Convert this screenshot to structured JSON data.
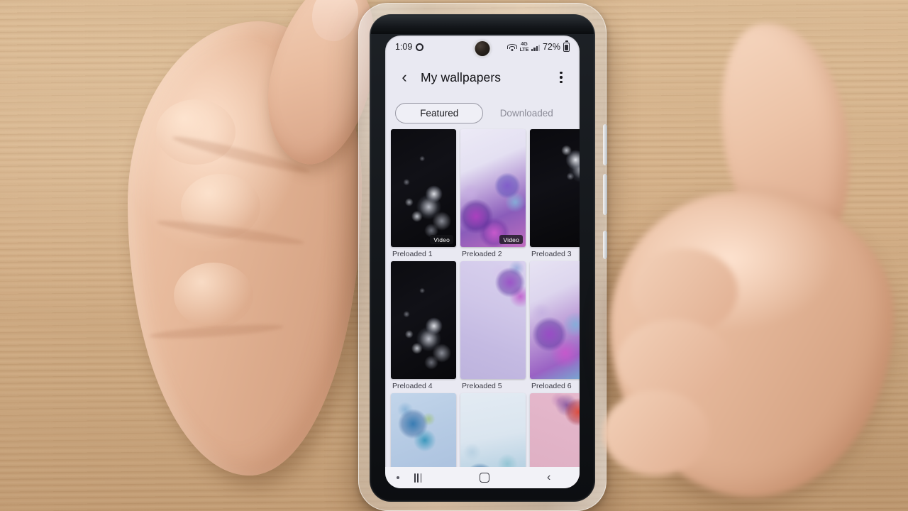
{
  "status_bar": {
    "time": "1:09",
    "settings_icon": "gear-icon",
    "wifi_icon": "wifi-icon",
    "network_label_top": "4G",
    "network_label_bottom": "LTE",
    "signal_icon": "signal-bars-icon",
    "battery_percent": "72%",
    "battery_icon": "battery-icon"
  },
  "app_bar": {
    "back_icon": "‹",
    "title": "My wallpapers",
    "more_icon": "overflow-menu-icon"
  },
  "tabs": [
    {
      "label": "Featured",
      "selected": true
    },
    {
      "label": "Downloaded",
      "selected": false
    }
  ],
  "grid": {
    "rows": [
      {
        "items": [
          {
            "caption": "Preloaded 1",
            "badge": "Video",
            "art": "wp-dark-1"
          },
          {
            "caption": "Preloaded 2",
            "badge": "Video",
            "art": "wp-purple-1"
          },
          {
            "caption": "Preloaded 3",
            "badge": "",
            "art": "wp-dark-2"
          }
        ]
      },
      {
        "items": [
          {
            "caption": "Preloaded 4",
            "badge": "",
            "art": "wp-dark-1"
          },
          {
            "caption": "Preloaded 5",
            "badge": "",
            "art": "wp-purple-2"
          },
          {
            "caption": "Preloaded 6",
            "badge": "",
            "art": "wp-purple-3"
          }
        ]
      },
      {
        "items": [
          {
            "caption": "",
            "badge": "",
            "art": "wp-blue-1"
          },
          {
            "caption": "",
            "badge": "",
            "art": "wp-blue-2"
          },
          {
            "caption": "",
            "badge": "",
            "art": "wp-pink-1"
          }
        ]
      }
    ]
  },
  "nav_bar": {
    "recents_icon": "recents-icon",
    "home_icon": "home-icon",
    "back_icon": "‹"
  },
  "colors": {
    "screen_bg": "#e9e9f2",
    "nav_bg": "#f2f2f7",
    "title_text": "#101014",
    "caption_text": "#3c3c46",
    "tab_inactive": "#8b8b97",
    "desk": "#d8b68f"
  }
}
